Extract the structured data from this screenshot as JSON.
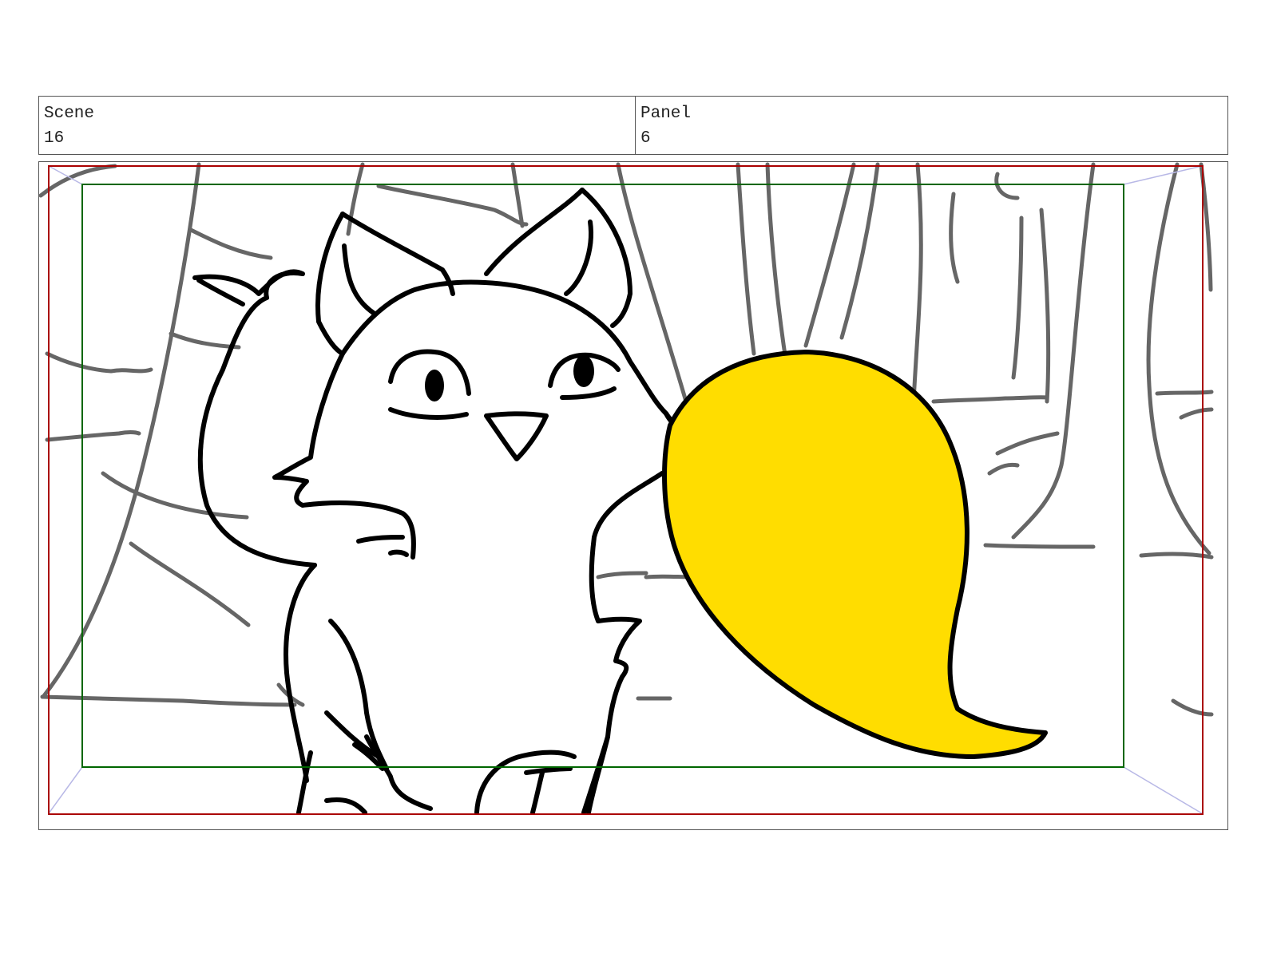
{
  "header": {
    "scene_label": "Scene",
    "scene_value": "16",
    "panel_label": "Panel",
    "panel_value": "6"
  },
  "drawing": {
    "description_icon": "storyboard-sketch",
    "colors": {
      "ink": "#000000",
      "background_lines": "#666666",
      "tail_fill": "#FFDD00",
      "action_safe": "#AA0000",
      "title_safe": "#006600",
      "camera_guides": "#B8B8E6"
    }
  }
}
